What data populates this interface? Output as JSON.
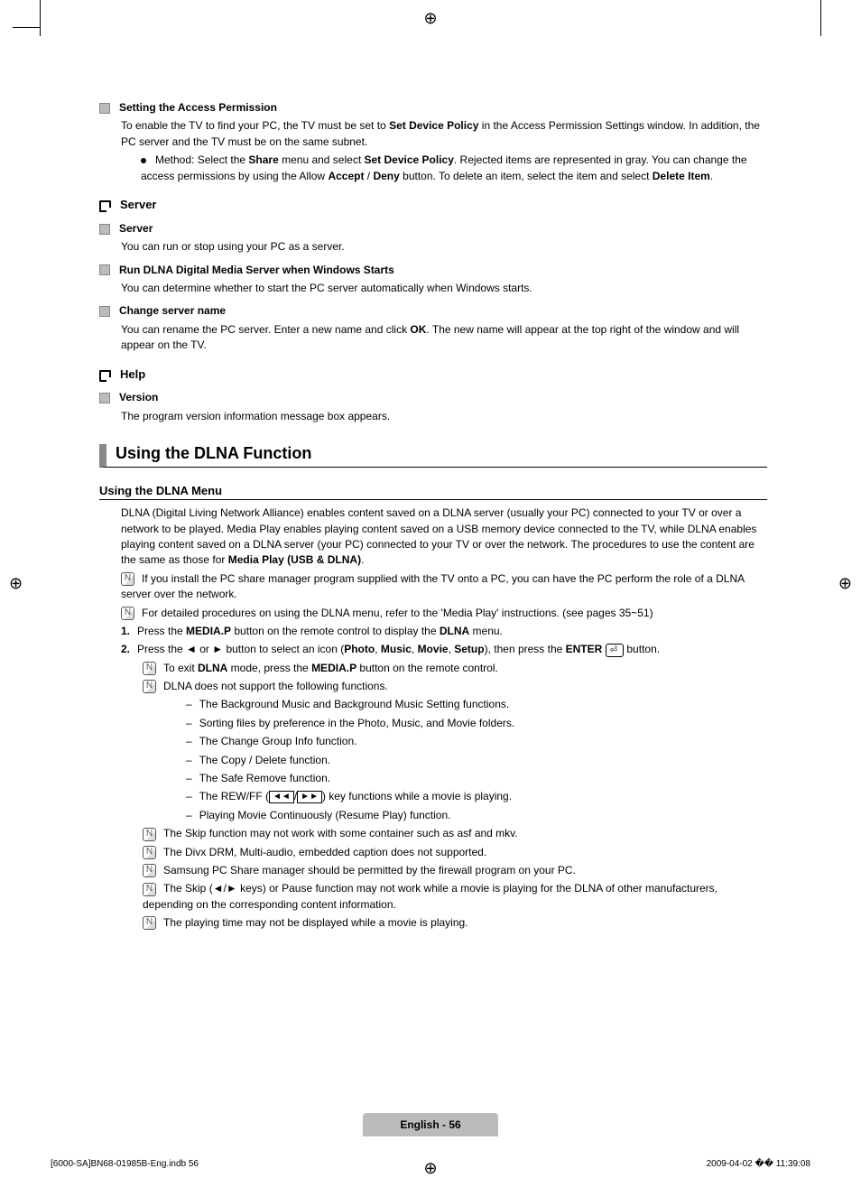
{
  "s1": {
    "title": "Setting the Access Permission",
    "p1a": "To enable the TV to find your PC, the TV must be set to ",
    "p1b": "Set Device Policy",
    "p1c": " in the Access Permission Settings window. In addition, the PC server and the TV must be on the same subnet.",
    "m1a": "Method: Select the ",
    "m1b": "Share",
    "m1c": " menu and select ",
    "m1d": "Set Device Policy",
    "m1e": ". Rejected items are represented in gray. You can change the access permissions by using the Allow ",
    "m1f": "Accept",
    "m1g": " / ",
    "m1h": "Deny",
    "m1i": " button. To delete an item, select the item and select ",
    "m1j": "Delete Item",
    "m1k": "."
  },
  "server": {
    "h": "Server",
    "s1t": "Server",
    "s1p": "You can run or stop using your PC as a server.",
    "s2t": "Run DLNA Digital Media Server when Windows Starts",
    "s2p": "You can determine whether to start the PC server automatically when Windows starts.",
    "s3t": "Change server name",
    "s3pa": "You can rename the PC server. Enter a new name and click ",
    "s3pb": "OK",
    "s3pc": ". The new name will appear at the top right of the window and will appear on the TV."
  },
  "help": {
    "h": "Help",
    "v": "Version",
    "vp": "The program version information message box appears."
  },
  "dlna": {
    "major": "Using the DLNA Function",
    "menuH": "Using the DLNA Menu",
    "p1a": "DLNA (Digital Living Network Alliance) enables content saved on a DLNA server (usually your PC) connected to your TV or over a network to be played. Media Play enables playing content saved on a USB memory device connected to the TV, while DLNA enables playing content saved on a DLNA server (your PC) connected to your TV or over the network. The procedures to use the content are the same as those for ",
    "p1b": "Media Play (USB & DLNA)",
    "p1c": ".",
    "n1": "If you install the PC share manager program supplied with the TV onto a PC, you can have the PC perform the role of a DLNA server over the network.",
    "n2": "For detailed procedures on using the DLNA menu, refer to the 'Media Play' instructions. (see pages 35~51)",
    "step1a": "Press the ",
    "step1b": "MEDIA.P",
    "step1c": " button on the remote control to display the ",
    "step1d": "DLNA",
    "step1e": " menu.",
    "step2a": "Press the ◄ or ► button to select an icon (",
    "step2b": "Photo",
    "step2c": ", ",
    "step2d": "Music",
    "step2e": ", ",
    "step2f": "Movie",
    "step2g": ", ",
    "step2h": "Setup",
    "step2i": "), then press the ",
    "step2j": "ENTER",
    "step2k": " button.",
    "s2n1a": "To exit ",
    "s2n1b": "DLNA",
    "s2n1c": " mode, press the ",
    "s2n1d": "MEDIA.P",
    "s2n1e": " button on the remote control.",
    "s2n2": "DLNA does not support the following functions.",
    "d1": "The Background Music and Background Music Setting functions.",
    "d2": "Sorting files by preference in the Photo, Music, and Movie folders.",
    "d3": "The Change Group Info function.",
    "d4": "The Copy / Delete function.",
    "d5": "The Safe Remove function.",
    "d6a": "The REW/FF (",
    "d6b": ") key functions while a movie is playing.",
    "d7": "Playing Movie Continuously (Resume Play) function.",
    "n3": "The Skip function may not work with some container such as asf and mkv.",
    "n4": "The Divx DRM, Multi-audio, embedded caption does not supported.",
    "n5": "Samsung PC Share manager should be permitted by the firewall program on your PC.",
    "n6": "The Skip (◄/► keys) or Pause function may not work while a movie is playing for the DLNA of other manufacturers, depending on the corresponding content information.",
    "n7": "The playing time may not be displayed while a movie is playing."
  },
  "footer": {
    "page": "English - 56",
    "printLeft": "[6000-SA]BN68-01985B-Eng.indb   56",
    "printRight": "2009-04-02   �� 11:39:08"
  }
}
